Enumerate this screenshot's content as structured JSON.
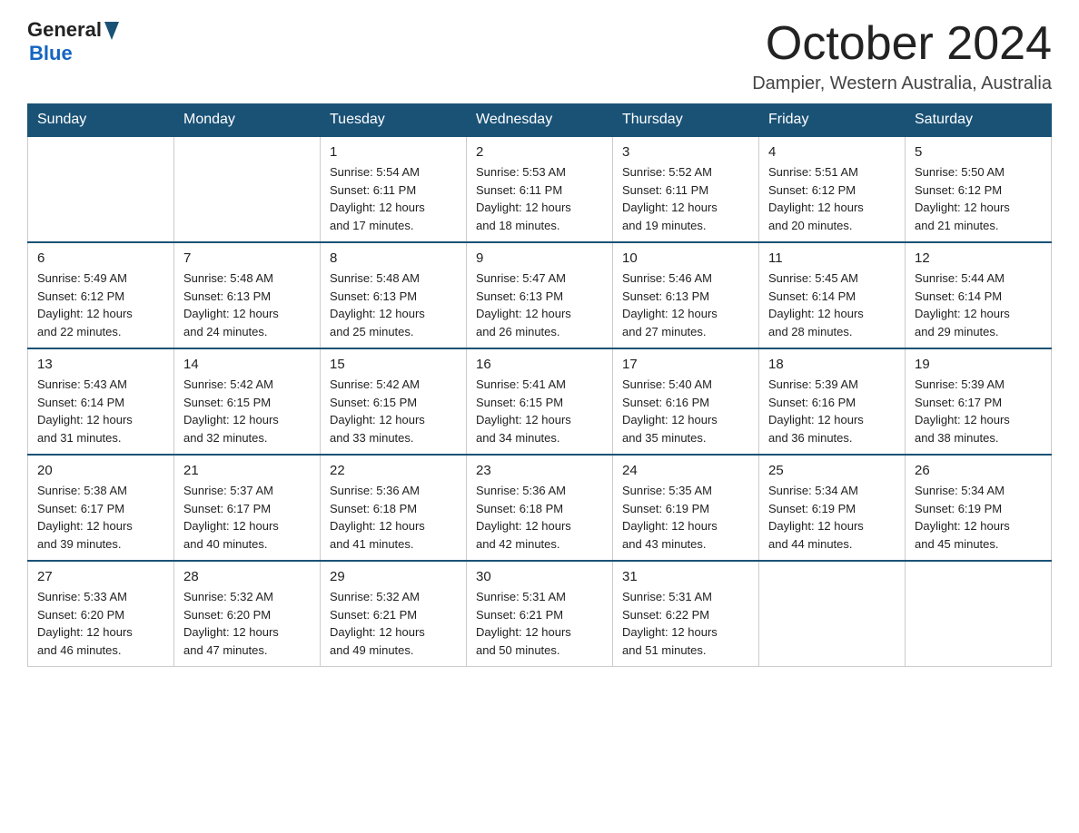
{
  "header": {
    "logo_general": "General",
    "logo_blue": "Blue",
    "month_title": "October 2024",
    "location": "Dampier, Western Australia, Australia"
  },
  "days_of_week": [
    "Sunday",
    "Monday",
    "Tuesday",
    "Wednesday",
    "Thursday",
    "Friday",
    "Saturday"
  ],
  "weeks": [
    [
      {
        "day": "",
        "info": ""
      },
      {
        "day": "",
        "info": ""
      },
      {
        "day": "1",
        "info": "Sunrise: 5:54 AM\nSunset: 6:11 PM\nDaylight: 12 hours\nand 17 minutes."
      },
      {
        "day": "2",
        "info": "Sunrise: 5:53 AM\nSunset: 6:11 PM\nDaylight: 12 hours\nand 18 minutes."
      },
      {
        "day": "3",
        "info": "Sunrise: 5:52 AM\nSunset: 6:11 PM\nDaylight: 12 hours\nand 19 minutes."
      },
      {
        "day": "4",
        "info": "Sunrise: 5:51 AM\nSunset: 6:12 PM\nDaylight: 12 hours\nand 20 minutes."
      },
      {
        "day": "5",
        "info": "Sunrise: 5:50 AM\nSunset: 6:12 PM\nDaylight: 12 hours\nand 21 minutes."
      }
    ],
    [
      {
        "day": "6",
        "info": "Sunrise: 5:49 AM\nSunset: 6:12 PM\nDaylight: 12 hours\nand 22 minutes."
      },
      {
        "day": "7",
        "info": "Sunrise: 5:48 AM\nSunset: 6:13 PM\nDaylight: 12 hours\nand 24 minutes."
      },
      {
        "day": "8",
        "info": "Sunrise: 5:48 AM\nSunset: 6:13 PM\nDaylight: 12 hours\nand 25 minutes."
      },
      {
        "day": "9",
        "info": "Sunrise: 5:47 AM\nSunset: 6:13 PM\nDaylight: 12 hours\nand 26 minutes."
      },
      {
        "day": "10",
        "info": "Sunrise: 5:46 AM\nSunset: 6:13 PM\nDaylight: 12 hours\nand 27 minutes."
      },
      {
        "day": "11",
        "info": "Sunrise: 5:45 AM\nSunset: 6:14 PM\nDaylight: 12 hours\nand 28 minutes."
      },
      {
        "day": "12",
        "info": "Sunrise: 5:44 AM\nSunset: 6:14 PM\nDaylight: 12 hours\nand 29 minutes."
      }
    ],
    [
      {
        "day": "13",
        "info": "Sunrise: 5:43 AM\nSunset: 6:14 PM\nDaylight: 12 hours\nand 31 minutes."
      },
      {
        "day": "14",
        "info": "Sunrise: 5:42 AM\nSunset: 6:15 PM\nDaylight: 12 hours\nand 32 minutes."
      },
      {
        "day": "15",
        "info": "Sunrise: 5:42 AM\nSunset: 6:15 PM\nDaylight: 12 hours\nand 33 minutes."
      },
      {
        "day": "16",
        "info": "Sunrise: 5:41 AM\nSunset: 6:15 PM\nDaylight: 12 hours\nand 34 minutes."
      },
      {
        "day": "17",
        "info": "Sunrise: 5:40 AM\nSunset: 6:16 PM\nDaylight: 12 hours\nand 35 minutes."
      },
      {
        "day": "18",
        "info": "Sunrise: 5:39 AM\nSunset: 6:16 PM\nDaylight: 12 hours\nand 36 minutes."
      },
      {
        "day": "19",
        "info": "Sunrise: 5:39 AM\nSunset: 6:17 PM\nDaylight: 12 hours\nand 38 minutes."
      }
    ],
    [
      {
        "day": "20",
        "info": "Sunrise: 5:38 AM\nSunset: 6:17 PM\nDaylight: 12 hours\nand 39 minutes."
      },
      {
        "day": "21",
        "info": "Sunrise: 5:37 AM\nSunset: 6:17 PM\nDaylight: 12 hours\nand 40 minutes."
      },
      {
        "day": "22",
        "info": "Sunrise: 5:36 AM\nSunset: 6:18 PM\nDaylight: 12 hours\nand 41 minutes."
      },
      {
        "day": "23",
        "info": "Sunrise: 5:36 AM\nSunset: 6:18 PM\nDaylight: 12 hours\nand 42 minutes."
      },
      {
        "day": "24",
        "info": "Sunrise: 5:35 AM\nSunset: 6:19 PM\nDaylight: 12 hours\nand 43 minutes."
      },
      {
        "day": "25",
        "info": "Sunrise: 5:34 AM\nSunset: 6:19 PM\nDaylight: 12 hours\nand 44 minutes."
      },
      {
        "day": "26",
        "info": "Sunrise: 5:34 AM\nSunset: 6:19 PM\nDaylight: 12 hours\nand 45 minutes."
      }
    ],
    [
      {
        "day": "27",
        "info": "Sunrise: 5:33 AM\nSunset: 6:20 PM\nDaylight: 12 hours\nand 46 minutes."
      },
      {
        "day": "28",
        "info": "Sunrise: 5:32 AM\nSunset: 6:20 PM\nDaylight: 12 hours\nand 47 minutes."
      },
      {
        "day": "29",
        "info": "Sunrise: 5:32 AM\nSunset: 6:21 PM\nDaylight: 12 hours\nand 49 minutes."
      },
      {
        "day": "30",
        "info": "Sunrise: 5:31 AM\nSunset: 6:21 PM\nDaylight: 12 hours\nand 50 minutes."
      },
      {
        "day": "31",
        "info": "Sunrise: 5:31 AM\nSunset: 6:22 PM\nDaylight: 12 hours\nand 51 minutes."
      },
      {
        "day": "",
        "info": ""
      },
      {
        "day": "",
        "info": ""
      }
    ]
  ]
}
